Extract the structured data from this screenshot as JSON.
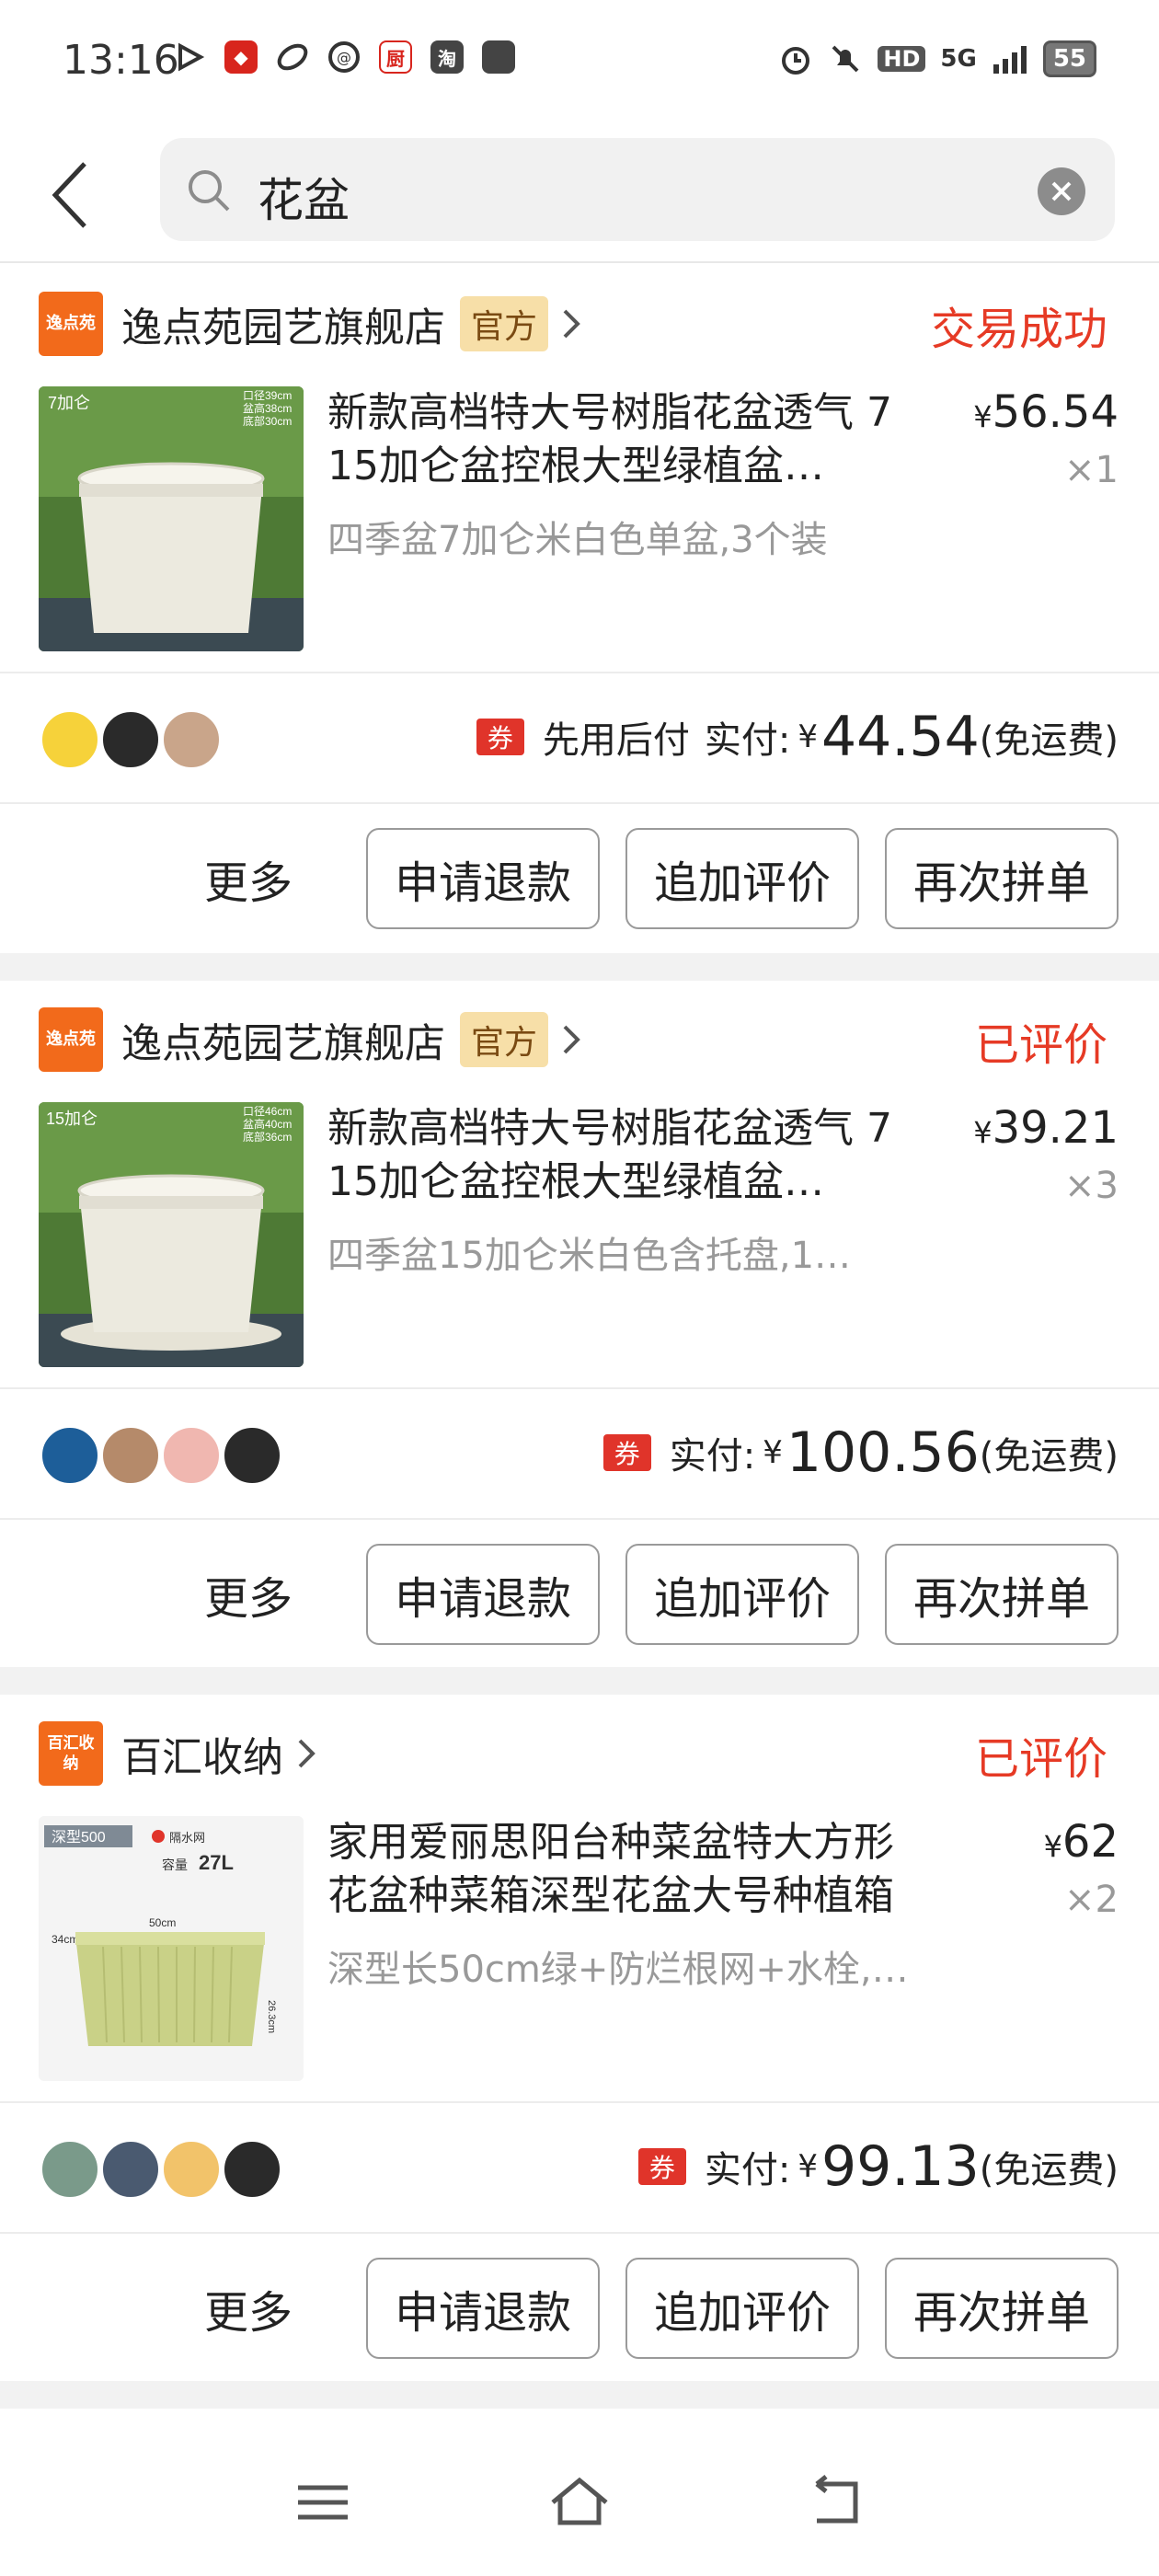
{
  "status_bar": {
    "time": "13:16",
    "network": "5G",
    "battery": "55",
    "hd": "HD"
  },
  "search": {
    "query": "花盆"
  },
  "orders": [
    {
      "shop_name": "逸点苑园艺旗舰店",
      "shop_logo_text": "逸点苑",
      "official_badge": "官方",
      "status": "交易成功",
      "title": "新款高档特大号树脂花盆透气 7 15加仑盆控根大型绿植盆…",
      "spec": "四季盆7加仑米白色单盆,3个装",
      "price": "56.54",
      "currency": "¥",
      "quantity": "×1",
      "pay_later": "先用后付",
      "paid_label": "实付:",
      "paid_amount": "44.54",
      "shipping": "(免运费)",
      "thumb_label": "7加仑",
      "thumb_dims": [
        "口径39cm",
        "盆高38cm",
        "底部30cm"
      ]
    },
    {
      "shop_name": "逸点苑园艺旗舰店",
      "shop_logo_text": "逸点苑",
      "official_badge": "官方",
      "status": "已评价",
      "title": "新款高档特大号树脂花盆透气 7 15加仑盆控根大型绿植盆…",
      "spec": "四季盆15加仑米白色含托盘,1…",
      "price": "39.21",
      "currency": "¥",
      "quantity": "×3",
      "paid_label": "实付:",
      "paid_amount": "100.56",
      "shipping": "(免运费)",
      "thumb_label": "15加仑",
      "thumb_dims": [
        "口径46cm",
        "盆高40cm",
        "底部36cm"
      ]
    },
    {
      "shop_name": "百汇收纳",
      "shop_logo_text": "百汇收纳",
      "status": "已评价",
      "title": "家用爱丽思阳台种菜盆特大方形花盆种菜箱深型花盆大号种植箱户外",
      "spec": "深型长50cm绿+防烂根网+水栓,…",
      "price": "62",
      "currency": "¥",
      "quantity": "×2",
      "paid_label": "实付:",
      "paid_amount": "99.13",
      "shipping": "(免运费)",
      "thumb_label": "深型500",
      "thumb_extra": [
        "隔水网",
        "容量",
        "27L",
        "50cm",
        "34cm",
        "26.3cm"
      ]
    }
  ],
  "actions": {
    "coupon": "券",
    "more": "更多",
    "refund": "申请退款",
    "add_review": "追加评价",
    "reorder": "再次拼单"
  },
  "colors": {
    "accent_red": "#e63a25",
    "shop_orange": "#f26a1b",
    "official_bg": "#f7dfa8"
  }
}
